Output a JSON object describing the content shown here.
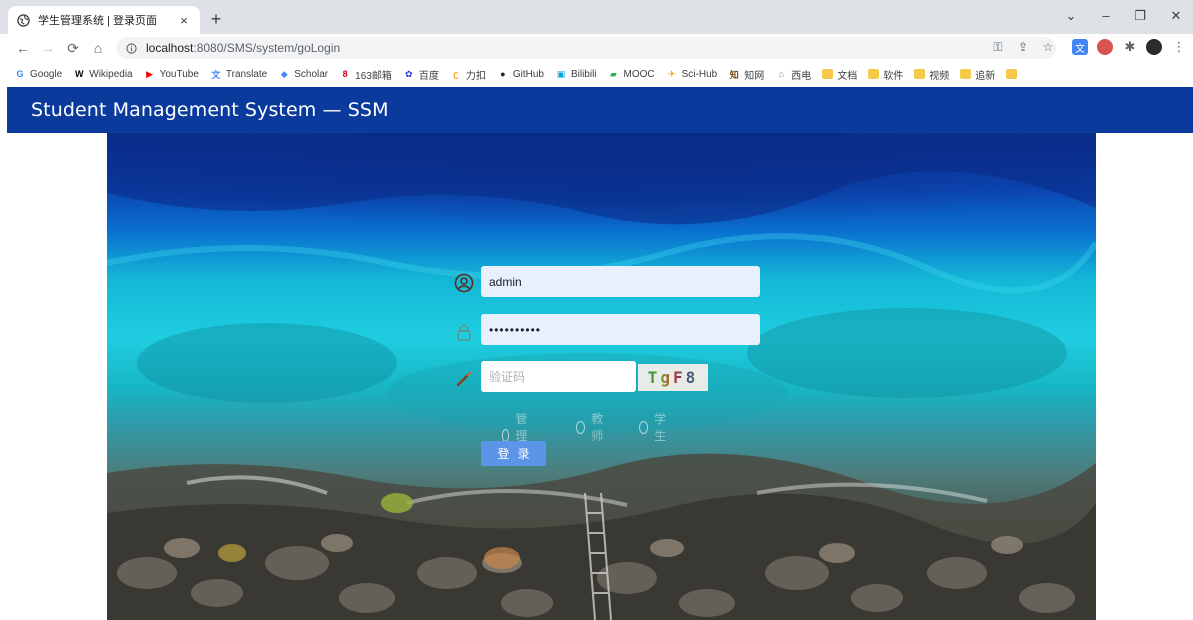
{
  "browser": {
    "tab_title": "学生管理系统 | 登录页面",
    "tab_close": "×",
    "new_tab": "+",
    "url_host": "localhost",
    "url_path": ":8080/SMS/system/goLogin",
    "window_controls": [
      "⌄",
      "–",
      "❐",
      "✕"
    ],
    "bookmarks": [
      {
        "icon": "google-icon",
        "label": "Google",
        "color": "#4285f4",
        "glyph": "G"
      },
      {
        "icon": "wikipedia-icon",
        "label": "Wikipedia",
        "color": "#000000",
        "glyph": "W"
      },
      {
        "icon": "youtube-icon",
        "label": "YouTube",
        "color": "#ff0000",
        "glyph": "▶"
      },
      {
        "icon": "translate-icon",
        "label": "Translate",
        "color": "#4285f4",
        "glyph": "文"
      },
      {
        "icon": "scholar-icon",
        "label": "Scholar",
        "color": "#4285f4",
        "glyph": "◆"
      },
      {
        "icon": "163-mail-icon",
        "label": "163邮箱",
        "color": "#d0021b",
        "glyph": "8"
      },
      {
        "icon": "baidu-icon",
        "label": "百度",
        "color": "#2932e1",
        "glyph": "✿"
      },
      {
        "icon": "leetcode-icon",
        "label": "力扣",
        "color": "#f89f1b",
        "glyph": "ʗ"
      },
      {
        "icon": "github-icon",
        "label": "GitHub",
        "color": "#24292e",
        "glyph": "●"
      },
      {
        "icon": "bilibili-icon",
        "label": "Bilibili",
        "color": "#00a1d6",
        "glyph": "▣"
      },
      {
        "icon": "mooc-icon",
        "label": "MOOC",
        "color": "#23b14d",
        "glyph": "▰"
      },
      {
        "icon": "scihub-icon",
        "label": "Sci-Hub",
        "color": "#f0a30a",
        "glyph": "✈"
      },
      {
        "icon": "zhihu-icon",
        "label": "知网",
        "color": "#7a4a1a",
        "glyph": "知"
      },
      {
        "icon": "xidian-icon",
        "label": "西电",
        "color": "#7f8c8d",
        "glyph": "⌂"
      },
      {
        "icon": "folder-icon",
        "label": "文档",
        "color": "#f7c948",
        "glyph": ""
      },
      {
        "icon": "folder-icon",
        "label": "软件",
        "color": "#f7c948",
        "glyph": ""
      },
      {
        "icon": "folder-icon",
        "label": "视频",
        "color": "#f7c948",
        "glyph": ""
      },
      {
        "icon": "folder-icon",
        "label": "追新",
        "color": "#f7c948",
        "glyph": ""
      },
      {
        "icon": "folder-icon",
        "label": "",
        "color": "#f7c948",
        "glyph": ""
      }
    ]
  },
  "app": {
    "brand": "Student Management System — SSM",
    "header_color": "#0a3a9c"
  },
  "login": {
    "username_value": "admin",
    "password_value": "••••••••••",
    "captcha_placeholder": "验证码",
    "captcha_text": "TgF8",
    "roles": [
      "管理员",
      "教师",
      "学生"
    ],
    "submit_label": "登录"
  }
}
